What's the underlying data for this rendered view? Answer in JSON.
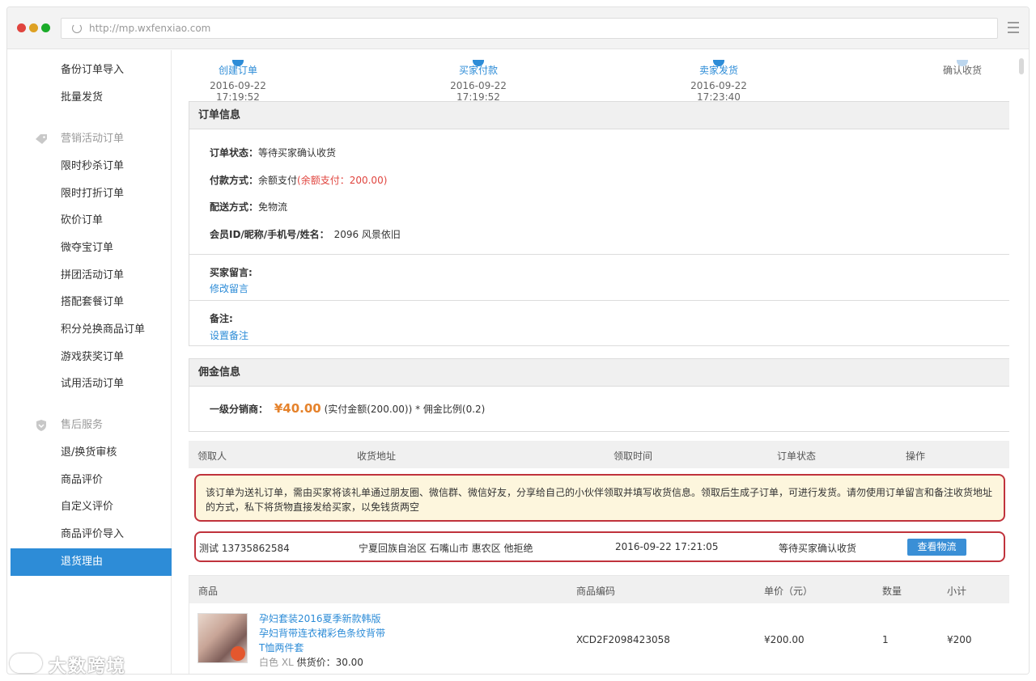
{
  "browser": {
    "url": "http://mp.wxfenxiao.com"
  },
  "sidebar": {
    "top_items": [
      "备份订单导入",
      "批量发货"
    ],
    "group_marketing": {
      "label": "营销活动订单",
      "icon": "tag-icon"
    },
    "marketing_items": [
      "限时秒杀订单",
      "限时打折订单",
      "砍价订单",
      "微夺宝订单",
      "拼团活动订单",
      "搭配套餐订单",
      "积分兑换商品订单",
      "游戏获奖订单",
      "试用活动订单"
    ],
    "group_aftersale": {
      "label": "售后服务",
      "icon": "shield-icon"
    },
    "aftersale_items": [
      "退/换货审核",
      "商品评价",
      "自定义评价",
      "商品评价导入",
      "退货理由"
    ],
    "active_item": "退货理由"
  },
  "steps": [
    {
      "label": "创建订单",
      "time": "2016-09-22 17:19:52"
    },
    {
      "label": "买家付款",
      "time": "2016-09-22 17:19:52"
    },
    {
      "label": "卖家发货",
      "time": "2016-09-22 17:23:40"
    },
    {
      "label": "确认收货",
      "time": ""
    }
  ],
  "order_info": {
    "title": "订单信息",
    "status_label": "订单状态：",
    "status_value": "等待买家确认收货",
    "pay_label": "付款方式：",
    "pay_value": "余额支付",
    "pay_detail": "(余额支付：200.00)",
    "ship_label": "配送方式：",
    "ship_value": "免物流",
    "member_label": "会员ID/昵称/手机号/姓名：",
    "member_value": "2096 风景依旧",
    "buyer_msg_label": "买家留言:",
    "buyer_msg_link": "修改留言",
    "remark_label": "备注:",
    "remark_link": "设置备注"
  },
  "commission": {
    "title": "佣金信息",
    "level_label": "一级分销商：",
    "amount": "¥40.00",
    "detail": "(实付金额(200.00)) * 佣金比例(0.2)"
  },
  "gift_table": {
    "headers": [
      "领取人",
      "收货地址",
      "领取时间",
      "订单状态",
      "操作"
    ],
    "notice": "该订单为送礼订单，需由买家将该礼单通过朋友圈、微信群、微信好友，分享给自己的小伙伴领取并填写收货信息。领取后生成子订单，可进行发货。请勿使用订单留言和备注收货地址的方式，私下将货物直接发给买家，以免钱货两空",
    "row": {
      "receiver": "测试  13735862584",
      "address": "宁夏回族自治区 石嘴山市 惠农区 他拒绝",
      "time": "2016-09-22 17:21:05",
      "status": "等待买家确认收货",
      "action": "查看物流"
    }
  },
  "goods": {
    "headers": [
      "商品",
      "商品编码",
      "单价（元）",
      "数量",
      "小计"
    ],
    "item": {
      "name": "孕妇套装2016夏季新款韩版孕妇背带连衣裙彩色条纹背带T恤两件套",
      "spec": "白色 XL",
      "supply_label": "供货价：30.00",
      "code": "XCD2F2098423058",
      "price": "¥200.00",
      "qty": "1",
      "subtotal": "¥200"
    }
  },
  "watermark": "大数跨境",
  "colors": {
    "accent": "#2d8cd7",
    "alert_border": "#c0333c",
    "amount": "#e5822b"
  }
}
